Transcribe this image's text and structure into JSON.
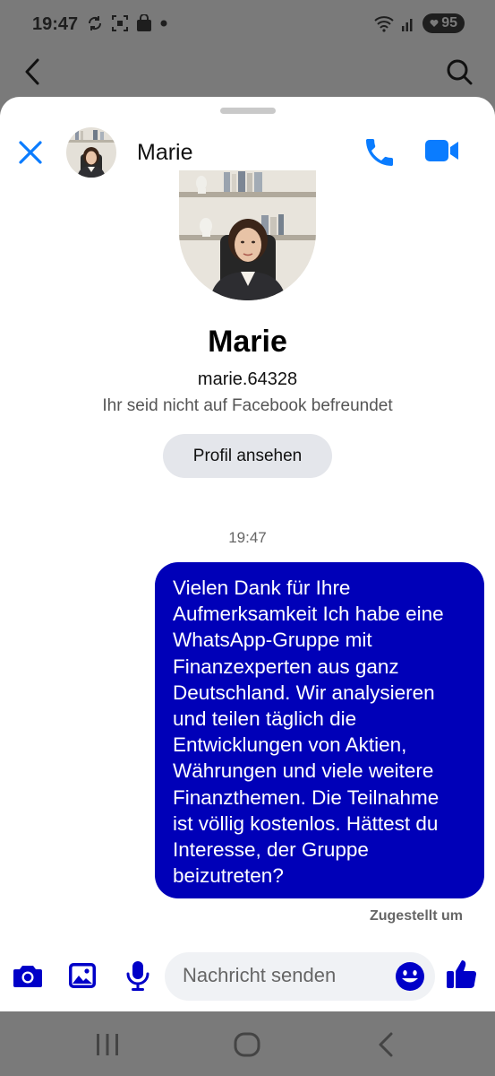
{
  "status_bar": {
    "time": "19:47",
    "battery": "95"
  },
  "header": {
    "contact_name": "Marie"
  },
  "profile": {
    "name": "Marie",
    "username": "marie.64328",
    "relationship_note": "Ihr seid nicht auf Facebook befreundet",
    "view_profile_label": "Profil ansehen"
  },
  "conversation": {
    "timestamp": "19:47",
    "messages": [
      {
        "sender": "me",
        "text": "Vielen Dank für Ihre\nAufmerksamkeit Ich habe eine\nWhatsApp-Gruppe mit\nFinanzexperten aus ganz\nDeutschland. Wir analysieren\nund teilen täglich die\nEntwicklungen von Aktien,\nWährungen und viele weitere\nFinanzthemen. Die Teilnahme\nist völlig kostenlos. Hättest du\nInteresse, der Gruppe\nbeizutreten?"
      }
    ],
    "delivery_status": "Zugestellt um"
  },
  "composer": {
    "placeholder": "Nachricht senden"
  },
  "colors": {
    "messenger_blue": "#0a7cff",
    "bubble_blue": "#0000b8"
  },
  "icons": [
    "close-icon",
    "phone-icon",
    "video-icon",
    "camera-icon",
    "image-icon",
    "microphone-icon",
    "emoji-icon",
    "thumbs-up-icon",
    "back-icon",
    "search-icon"
  ]
}
